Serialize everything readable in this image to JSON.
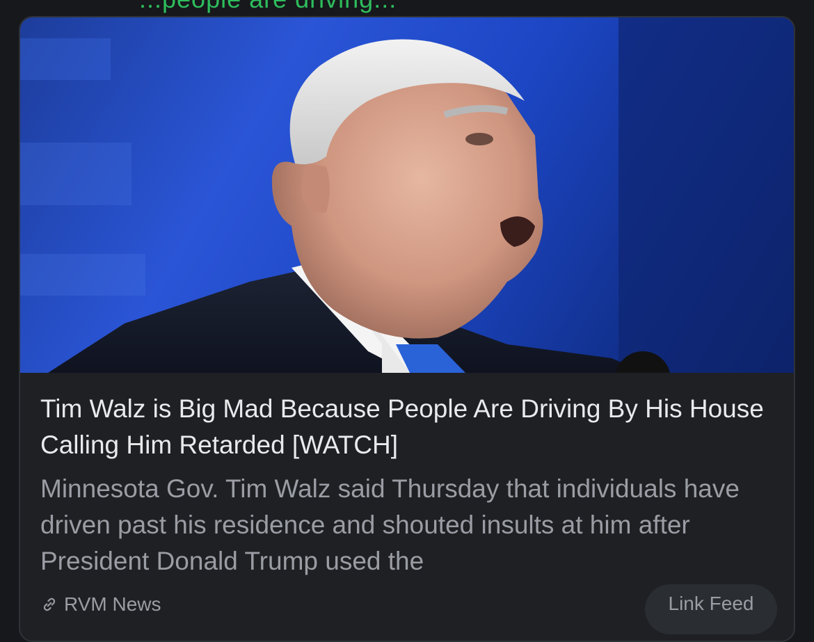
{
  "post": {
    "top_text": "...people are driving...",
    "headline": "Tim Walz is Big Mad Because People Are Driving By His House Calling Him Retarded [WATCH]",
    "description": "Minnesota Gov. Tim Walz said Thursday that individuals have driven past his residence and shouted insults at him after President Donald Trump used the",
    "source": "RVM News",
    "link_feed_label": "Link Feed",
    "image_subject": "Man speaking at podium in front of blue background"
  },
  "icons": {
    "source": "link-icon"
  },
  "colors": {
    "background": "#16181c",
    "card": "#1e2024",
    "headline": "#e9eaec",
    "secondary_text": "#9a9da3",
    "top_text": "#2ebd5c",
    "hero_blue": "#2a55d6"
  }
}
